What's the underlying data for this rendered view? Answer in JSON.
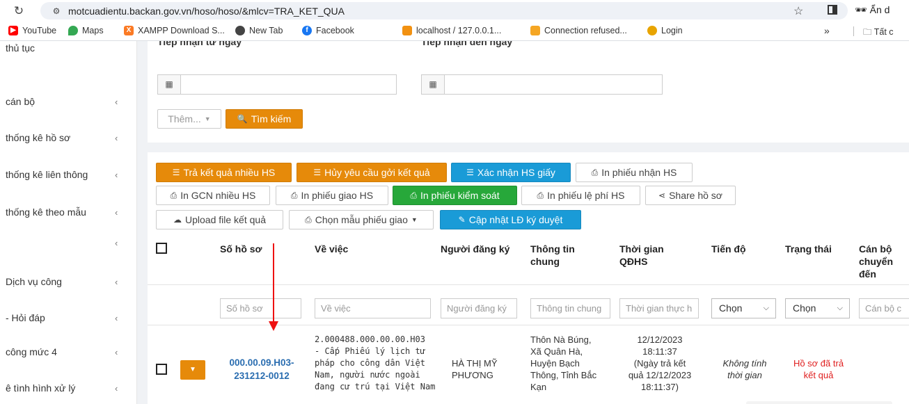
{
  "browser": {
    "url": "motcuadientu.backan.gov.vn/hoso/hoso/&mlcv=TRA_KET_QUA",
    "profile_label": "Ẩn d",
    "bookmarks": [
      {
        "label": "YouTube",
        "icon": "youtube-icon",
        "color": "#ff0000"
      },
      {
        "label": "Maps",
        "icon": "maps-icon",
        "color": "#34a853"
      },
      {
        "label": "XAMPP Download S...",
        "icon": "xampp-icon",
        "color": "#fb7a24"
      },
      {
        "label": "New Tab",
        "icon": "newtab-icon",
        "color": "#444444"
      },
      {
        "label": "Facebook",
        "icon": "facebook-icon",
        "color": "#1877f2"
      },
      {
        "label": "localhost / 127.0.0.1...",
        "icon": "phpmyadmin-icon",
        "color": "#f29111"
      },
      {
        "label": "Connection refused...",
        "icon": "connection-icon",
        "color": "#f5a623"
      },
      {
        "label": "Login",
        "icon": "login-icon",
        "color": "#e8a400"
      }
    ],
    "more_label": "»",
    "all_bookmarks_label": "Tất c"
  },
  "sidebar": {
    "items": [
      {
        "label": "thủ tục",
        "chevron": ""
      },
      {
        "label": "cán bộ",
        "chevron": "‹"
      },
      {
        "label": "thống kê hồ sơ",
        "chevron": "‹"
      },
      {
        "label": "thống kê liên thông",
        "chevron": "‹"
      },
      {
        "label": "thống kê theo mẫu",
        "chevron": "‹"
      },
      {
        "label": "",
        "chevron": "‹"
      },
      {
        "label": "Dịch vụ công",
        "chevron": "‹"
      },
      {
        "label": "- Hỏi đáp",
        "chevron": "‹"
      },
      {
        "label": "công mức 4",
        "chevron": "‹"
      },
      {
        "label": "ê tình hình xử lý",
        "chevron": "‹"
      }
    ]
  },
  "search": {
    "from_label": "Tiếp nhận từ ngày",
    "to_label": "Tiếp nhận đến ngày",
    "more_label": "Thêm...",
    "search_label": "Tìm kiếm"
  },
  "actions": {
    "row1": [
      {
        "label": "Trả kết quả nhiều HS",
        "style": "orange",
        "icon": "list-icon"
      },
      {
        "label": "Hủy yêu cầu gởi kết quả",
        "style": "orange",
        "icon": "list-icon"
      },
      {
        "label": "Xác nhận HS giấy",
        "style": "blue",
        "icon": "list-icon"
      },
      {
        "label": "In phiếu nhận HS",
        "style": "white",
        "icon": "print-icon"
      }
    ],
    "row2": [
      {
        "label": "In GCN nhiều HS",
        "style": "white",
        "icon": "print-icon"
      },
      {
        "label": "In phiếu giao HS",
        "style": "white",
        "icon": "print-icon"
      },
      {
        "label": "In phiếu kiểm soát",
        "style": "green",
        "icon": "print-icon"
      },
      {
        "label": "In phiếu lệ phí HS",
        "style": "white",
        "icon": "print-icon"
      },
      {
        "label": "Share hồ sơ",
        "style": "white",
        "icon": "share-icon"
      }
    ],
    "row3": [
      {
        "label": "Upload file kết quả",
        "style": "white",
        "icon": "upload-icon"
      },
      {
        "label": "Chọn mẫu phiếu giao",
        "style": "white",
        "icon": "print-icon"
      },
      {
        "label": "Cập nhật LĐ ký duyệt",
        "style": "blue",
        "icon": "edit-icon"
      }
    ]
  },
  "table": {
    "headers": {
      "so_ho_so": "Số hồ sơ",
      "ve_viec": "Về việc",
      "nguoi_dang_ky": "Người đăng ký",
      "thong_tin_chung_1": "Thông tin",
      "thong_tin_chung_2": "chung",
      "thoi_gian_1": "Thời gian",
      "thoi_gian_2": "QĐHS",
      "tien_do": "Tiến độ",
      "trang_thai": "Trạng thái",
      "can_bo_1": "Cán bộ",
      "can_bo_2": "chuyển",
      "can_bo_3": "đến"
    },
    "filters": {
      "so_ho_so": "Số hồ sơ",
      "ve_viec": "Về việc",
      "nguoi_dang_ky": "Người đăng ký",
      "thong_tin_chung": "Thông tin chung",
      "thoi_gian": "Thời gian thực h",
      "tien_do": "Chọn",
      "trang_thai": "Chọn",
      "can_bo": "Cán bộ c"
    },
    "rows": [
      {
        "so_ho_so_1": "000.00.09.H03-",
        "so_ho_so_2": "231212-0012",
        "ve_viec_1": "2.000488.000.00.00.H03",
        "ve_viec_2": "- Cấp Phiếu lý lịch tư",
        "ve_viec_3": "pháp cho công dân Việt",
        "ve_viec_4": "Nam, người nước ngoài",
        "ve_viec_5": "đang cư trú tại Việt Nam",
        "nguoi_dang_ky_1": "HÀ THỊ MỸ",
        "nguoi_dang_ky_2": "PHƯƠNG",
        "thong_tin_1": "Thôn Nà Búng,",
        "thong_tin_2": "Xã Quân Hà,",
        "thong_tin_3": "Huyện Bạch",
        "thong_tin_4": "Thông, Tỉnh Bắc",
        "thong_tin_5": "Kạn",
        "thoi_gian_1": "12/12/2023",
        "thoi_gian_2": "18:11:37",
        "thoi_gian_3": "(Ngày trả kết",
        "thoi_gian_4": "quả 12/12/2023",
        "thoi_gian_5": "18:11:37)",
        "tien_do_1": "Không tính",
        "tien_do_2": "thời gian",
        "trang_thai_1": "Hồ sơ đã trả",
        "trang_thai_2": "kết quả"
      }
    ]
  },
  "colors": {
    "orange": "#e68a0a",
    "blue": "#1a9bd7",
    "green": "#27a83a",
    "link": "#2a6db0",
    "status_red": "#e02020",
    "arrow": "#ee1111"
  }
}
